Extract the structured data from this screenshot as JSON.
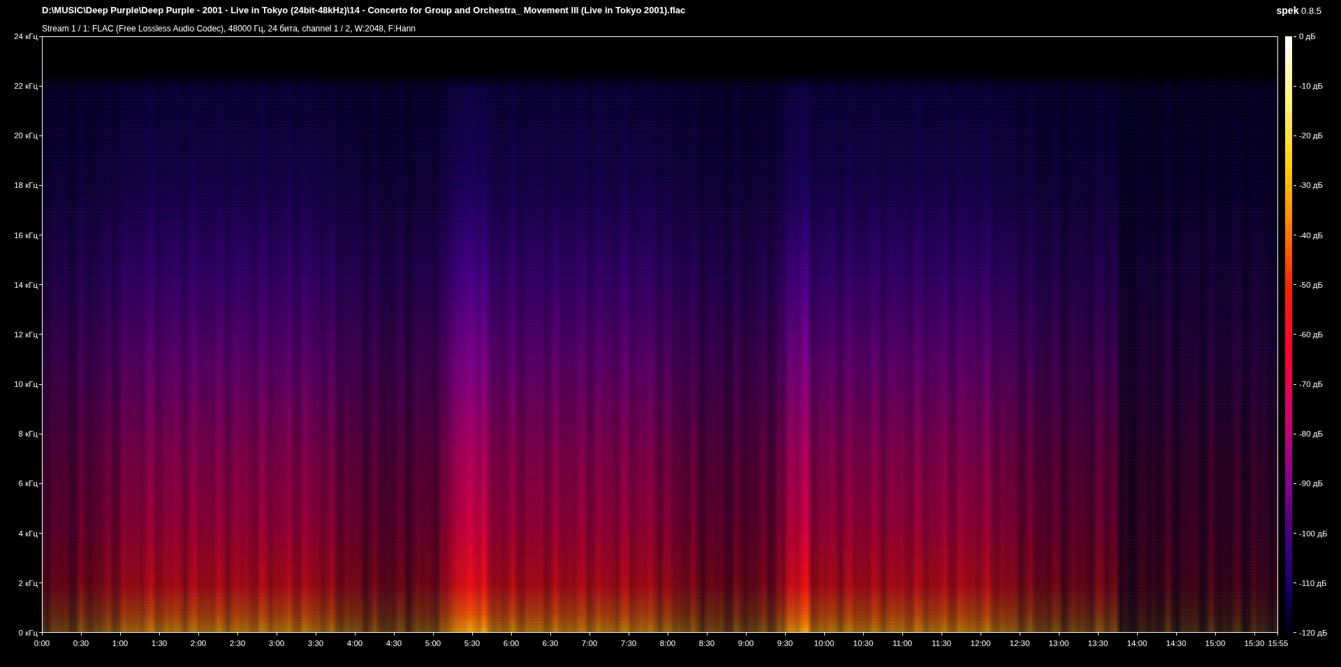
{
  "title": "D:\\MUSIC\\Deep Purple\\Deep Purple - 2001 - Live in Tokyo (24bit-48kHz)\\14 - Concerto for Group and Orchestra_ Movement III (Live in Tokyo 2001).flac",
  "app": {
    "name": "spek",
    "version": "0.8.5"
  },
  "stream_info": "Stream 1 / 1: FLAC (Free Lossless Audio Codec), 48000 Гц, 24 бита, channel 1 / 2, W:2048, F:Hann",
  "frequency_axis": {
    "ticks": [
      "24 кГц",
      "22 кГц",
      "20 кГц",
      "18 кГц",
      "16 кГц",
      "14 кГц",
      "12 кГц",
      "10 кГц",
      "8 кГц",
      "6 кГц",
      "4 кГц",
      "2 кГц",
      "0 кГц"
    ]
  },
  "time_axis": {
    "ticks": [
      "0:00",
      "0:30",
      "1:00",
      "1:30",
      "2:00",
      "2:30",
      "3:00",
      "3:30",
      "4:00",
      "4:30",
      "5:00",
      "5:30",
      "6:00",
      "6:30",
      "7:00",
      "7:30",
      "8:00",
      "8:30",
      "9:00",
      "9:30",
      "10:00",
      "10:30",
      "11:00",
      "11:30",
      "12:00",
      "12:30",
      "13:00",
      "13:30",
      "14:00",
      "14:30",
      "15:00",
      "15:30"
    ],
    "end": "15:55"
  },
  "level_scale": {
    "ticks": [
      "0 дБ",
      "-10 дБ",
      "-20 дБ",
      "-30 дБ",
      "-40 дБ",
      "-50 дБ",
      "-60 дБ",
      "-70 дБ",
      "-80 дБ",
      "-90 дБ",
      "-100 дБ",
      "-110 дБ",
      "-120 дБ"
    ]
  }
}
